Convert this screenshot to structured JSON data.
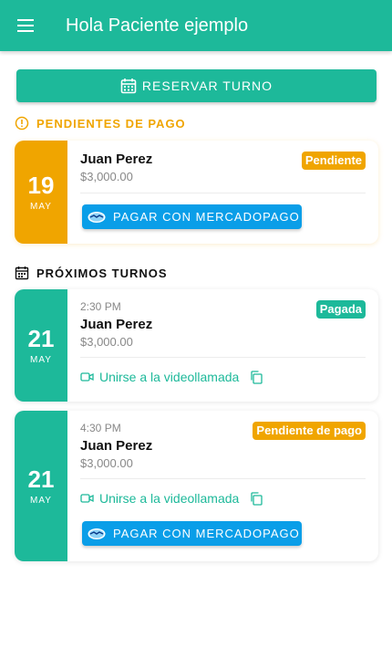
{
  "appbar": {
    "title": "Hola Paciente ejemplo",
    "menu_icon": "menu-icon"
  },
  "actions": {
    "reserve_label": "RESERVAR TURNO",
    "reserve_icon": "calendar-icon"
  },
  "pending_section": {
    "title": "PENDIENTES DE PAGO",
    "icon": "warning-icon",
    "items": [
      {
        "day": "19",
        "month": "MAY",
        "name": "Juan Perez",
        "price": "$3,000.00",
        "badge": "Pendiente",
        "pay_label": "PAGAR CON MERCADOPAGO"
      }
    ]
  },
  "upcoming_section": {
    "title": "PRÓXIMOS TURNOS",
    "icon": "calendar-icon",
    "items": [
      {
        "day": "21",
        "month": "MAY",
        "time": "2:30 PM",
        "name": "Juan Perez",
        "price": "$3,000.00",
        "badge": "Pagada",
        "video_label": "Unirse a la videollamada"
      },
      {
        "day": "21",
        "month": "MAY",
        "time": "4:30 PM",
        "name": "Juan Perez",
        "price": "$3,000.00",
        "badge": "Pendiente de pago",
        "video_label": "Unirse a la videollamada",
        "pay_label": "PAGAR CON MERCADOPAGO"
      }
    ]
  },
  "colors": {
    "primary": "#1db99a",
    "warning": "#f0a500",
    "mercadopago": "#0a9ee8"
  }
}
